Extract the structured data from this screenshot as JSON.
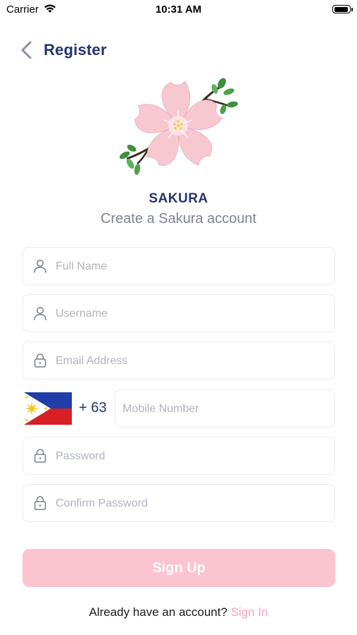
{
  "status_bar": {
    "carrier": "Carrier",
    "time": "10:31 AM"
  },
  "header": {
    "title": "Register",
    "back_icon": "chevron-left-icon"
  },
  "logo": {
    "icon": "sakura-flower-logo",
    "brand_name": "SAKURA",
    "subtitle": "Create a Sakura account"
  },
  "form": {
    "full_name": {
      "placeholder": "Full Name",
      "value": "",
      "icon": "user-icon"
    },
    "username": {
      "placeholder": "Username",
      "value": "",
      "icon": "user-icon"
    },
    "email": {
      "placeholder": "Email Address",
      "value": "",
      "icon": "lock-icon"
    },
    "mobile": {
      "flag": "philippines-flag",
      "dial_code": "+ 63",
      "placeholder": "Mobile Number",
      "value": ""
    },
    "password": {
      "placeholder": "Password",
      "value": "",
      "icon": "lock-icon"
    },
    "confirm_password": {
      "placeholder": "Confirm Password",
      "value": "",
      "icon": "lock-icon"
    },
    "submit_label": "Sign Up"
  },
  "footer": {
    "prompt": "Already have an account?",
    "link_label": "Sign In"
  },
  "colors": {
    "primary_navy": "#24356e",
    "button_pink": "#fcc3d0",
    "link_pink": "#f7a3b9",
    "placeholder_gray": "#b0b3bf"
  }
}
